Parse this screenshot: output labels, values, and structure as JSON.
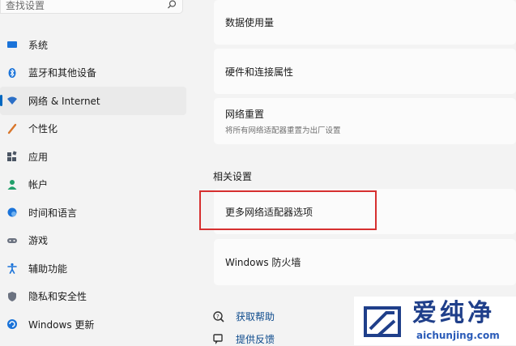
{
  "search": {
    "placeholder": "查找设置",
    "icon": "search-icon"
  },
  "sidebar": {
    "active_index": 2,
    "items": [
      {
        "label": "系统",
        "icon": "monitor-icon",
        "color": "#1a73d9"
      },
      {
        "label": "蓝牙和其他设备",
        "icon": "bluetooth-icon",
        "color": "#1a73d9"
      },
      {
        "label": "网络 & Internet",
        "icon": "wifi-icon",
        "color": "#2b6fc7"
      },
      {
        "label": "个性化",
        "icon": "brush-icon",
        "color": "#d9762b"
      },
      {
        "label": "应用",
        "icon": "apps-icon",
        "color": "#4b5563"
      },
      {
        "label": "帐户",
        "icon": "person-icon",
        "color": "#22a06b"
      },
      {
        "label": "时间和语言",
        "icon": "globe-clock-icon",
        "color": "#1a73d9"
      },
      {
        "label": "游戏",
        "icon": "gamepad-icon",
        "color": "#6b7280"
      },
      {
        "label": "辅助功能",
        "icon": "accessibility-icon",
        "color": "#1a73d9"
      },
      {
        "label": "隐私和安全性",
        "icon": "shield-icon",
        "color": "#6b7280"
      },
      {
        "label": "Windows 更新",
        "icon": "update-icon",
        "color": "#1a73d9"
      }
    ]
  },
  "main": {
    "cards": [
      {
        "title": "数据使用量"
      },
      {
        "title": "硬件和连接属性"
      },
      {
        "title": "网络重置",
        "desc": "将所有网络适配器重置为出厂设置"
      }
    ],
    "related_title": "相关设置",
    "related_cards": [
      {
        "title": "更多网络适配器选项",
        "highlighted": true
      },
      {
        "title": "Windows 防火墙"
      }
    ],
    "help_links": [
      {
        "label": "获取帮助",
        "icon": "help-icon"
      },
      {
        "label": "提供反馈",
        "icon": "feedback-icon"
      }
    ]
  },
  "watermark": {
    "title": "爱纯净",
    "url": "aichunjing.com",
    "color": "#1f3f8a"
  }
}
